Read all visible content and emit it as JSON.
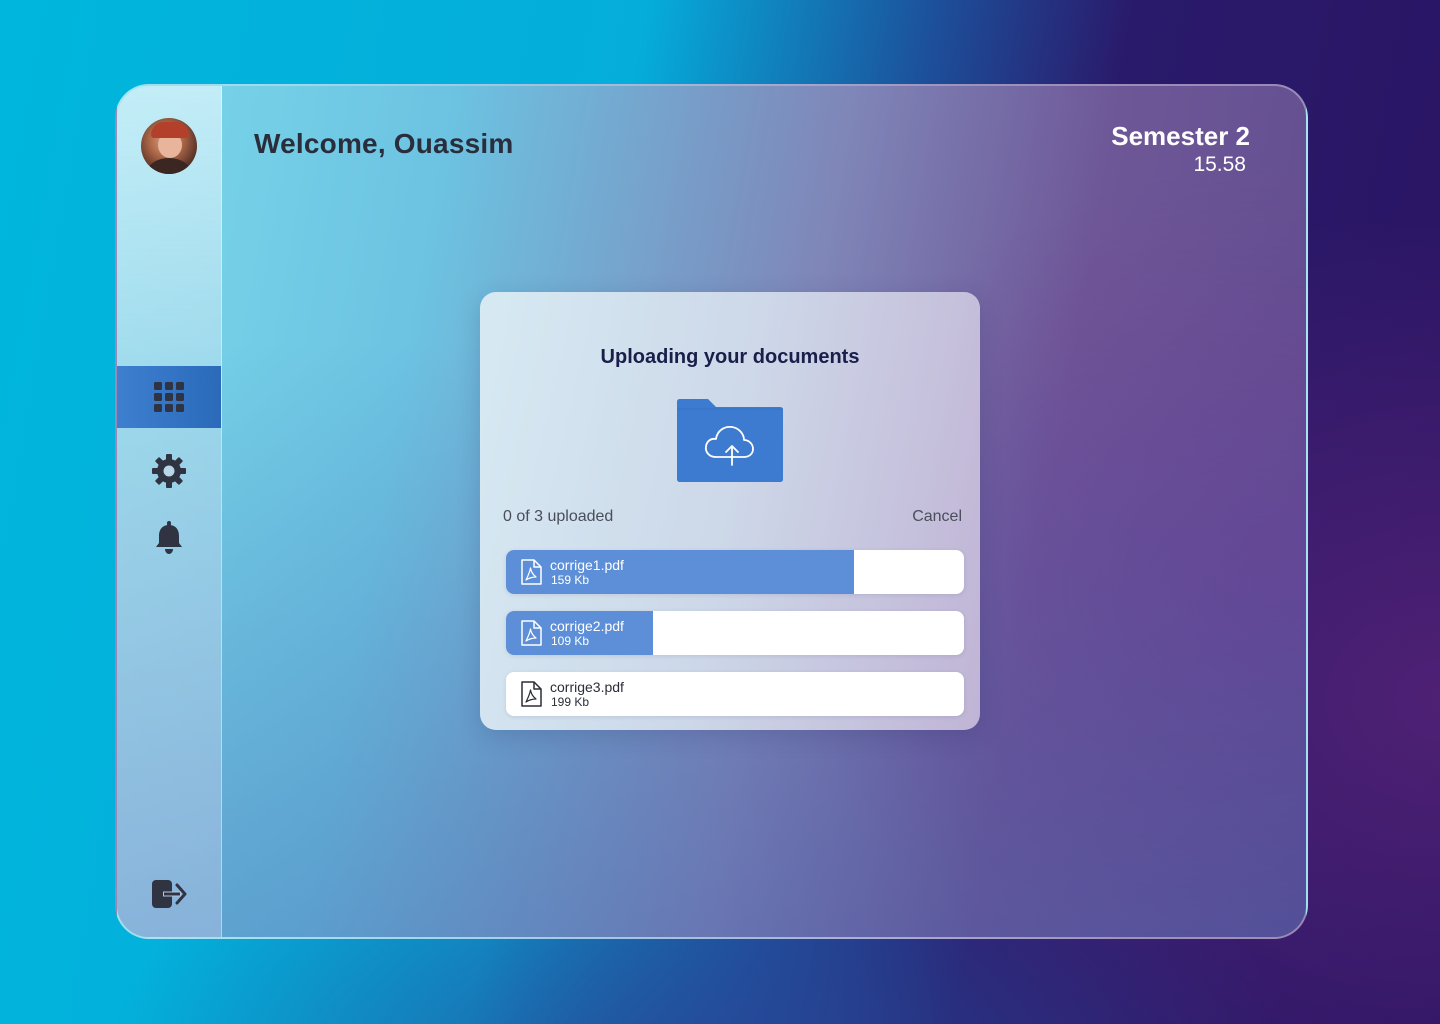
{
  "header": {
    "welcome_text": "Welcome, Ouassim",
    "semester_label": "Semester 2",
    "semester_score": "15.58"
  },
  "sidebar": {
    "items": [
      {
        "name": "dashboard",
        "icon": "grid-icon",
        "active": true
      },
      {
        "name": "settings",
        "icon": "gear-icon",
        "active": false
      },
      {
        "name": "notifications",
        "icon": "bell-icon",
        "active": false
      },
      {
        "name": "logout",
        "icon": "logout-icon",
        "active": false
      }
    ]
  },
  "upload_dialog": {
    "title": "Uploading your documents",
    "folder_icon": "folder-cloud-upload-icon",
    "status_text": "0 of 3 uploaded",
    "cancel_label": "Cancel",
    "files": [
      {
        "name": "corrige1.pdf",
        "size": "159 Kb",
        "progress": 0.76,
        "icon": "pdf-file-icon"
      },
      {
        "name": "corrige2.pdf",
        "size": "109 Kb",
        "progress": 0.32,
        "icon": "pdf-file-icon"
      },
      {
        "name": "corrige3.pdf",
        "size": "199 Kb",
        "progress": 0,
        "icon": "pdf-file-icon"
      }
    ]
  },
  "colors": {
    "accent": "#3e7fd0",
    "progress": "#5c8fd8",
    "folder": "#3e7fd0",
    "title_text": "#1a1f4a"
  }
}
